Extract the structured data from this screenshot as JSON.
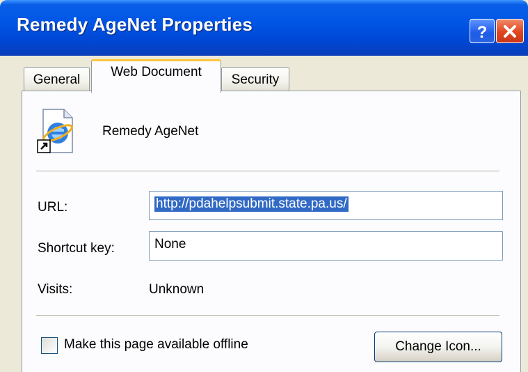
{
  "window": {
    "title": "Remedy AgeNet Properties",
    "help_label": "?",
    "close_icon": "close-icon"
  },
  "tabs": [
    {
      "label": "General",
      "active": false
    },
    {
      "label": "Web Document",
      "active": true
    },
    {
      "label": "Security",
      "active": false
    }
  ],
  "header": {
    "icon": "internet-shortcut-icon",
    "name": "Remedy AgeNet"
  },
  "fields": {
    "url_label": "URL:",
    "url_value": "http://pdahelpsubmit.state.pa.us/",
    "url_selected": true,
    "shortcut_label": "Shortcut key:",
    "shortcut_value": "None",
    "visits_label": "Visits:",
    "visits_value": "Unknown"
  },
  "offline": {
    "label": "Make this page available offline",
    "checked": false
  },
  "buttons": {
    "change_icon": "Change Icon..."
  },
  "colors": {
    "titlebar": "#0055e5",
    "selection": "#316ac5",
    "active_tab_accent": "#ffc83c",
    "close_button": "#e0461f"
  }
}
